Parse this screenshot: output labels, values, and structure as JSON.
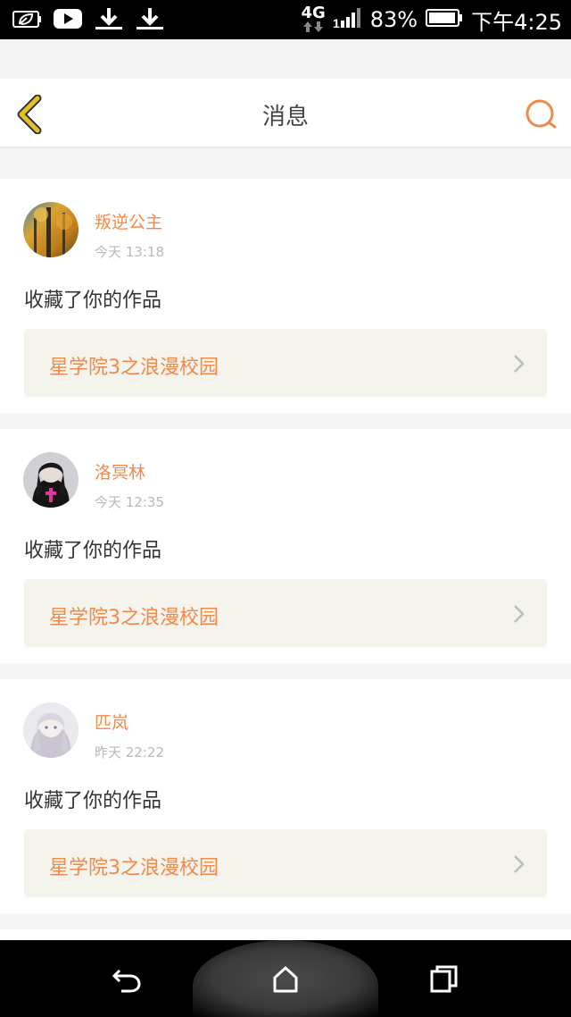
{
  "status_bar": {
    "network": "4G",
    "battery": "83%",
    "time": "下午4:25"
  },
  "header": {
    "title": "消息"
  },
  "colors": {
    "accent": "#f08a4b",
    "back_icon": "#e2c02a"
  },
  "messages": [
    {
      "user": "叛逆公主",
      "time": "今天  13:18",
      "action": "收藏了你的作品",
      "work": "星学院3之浪漫校园"
    },
    {
      "user": "洛冥林",
      "time": "今天  12:35",
      "action": "收藏了你的作品",
      "work": "星学院3之浪漫校园"
    },
    {
      "user": "匹岚",
      "time": "昨天  22:22",
      "action": "收藏了你的作品",
      "work": "星学院3之浪漫校园"
    }
  ]
}
